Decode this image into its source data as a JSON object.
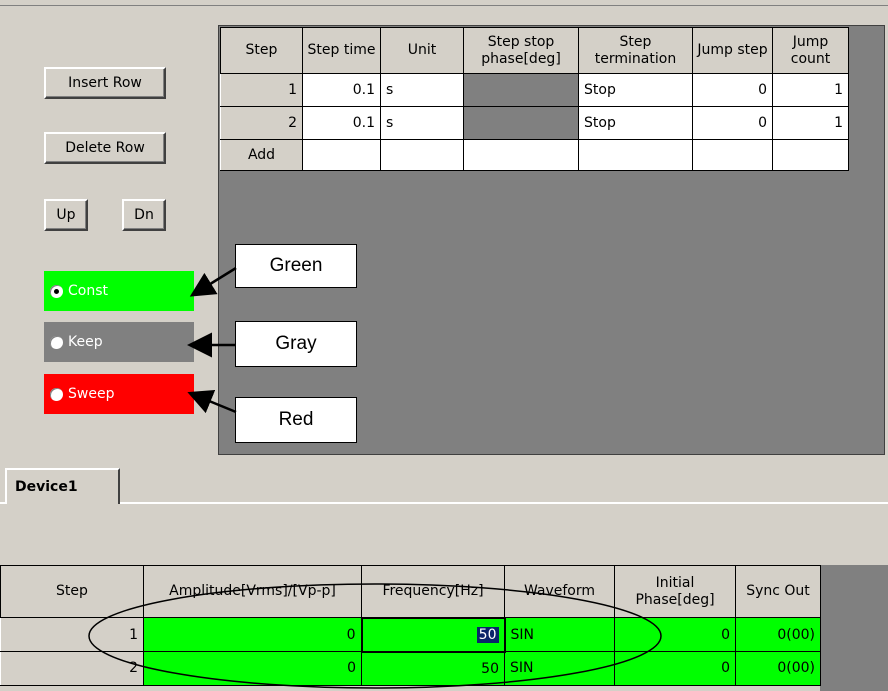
{
  "buttons": {
    "insert_row": "Insert Row",
    "delete_row": "Delete Row",
    "up": "Up",
    "dn": "Dn"
  },
  "modes": [
    {
      "label": "Const",
      "checked": true,
      "color": "#00ff00"
    },
    {
      "label": "Keep",
      "checked": false,
      "color": "#808080"
    },
    {
      "label": "Sweep",
      "checked": false,
      "color": "#ff0000"
    }
  ],
  "callouts": {
    "green": "Green",
    "gray": "Gray",
    "red": "Red"
  },
  "step_table": {
    "headers": {
      "step": "Step",
      "step_time": "Step time",
      "unit": "Unit",
      "phase": "Step stop phase[deg]",
      "termination": "Step termination",
      "jump_step": "Jump step",
      "jump_count": "Jump count"
    },
    "rows": [
      {
        "step": "1",
        "step_time": "0.1",
        "unit": "s",
        "termination": "Stop",
        "jump_step": "0",
        "jump_count": "1"
      },
      {
        "step": "2",
        "step_time": "0.1",
        "unit": "s",
        "termination": "Stop",
        "jump_step": "0",
        "jump_count": "1"
      }
    ],
    "add_label": "Add"
  },
  "tab": {
    "label": "Device1"
  },
  "device_table": {
    "headers": {
      "step": "Step",
      "amplitude": "Amplitude[Vrms]/[Vp-p]",
      "frequency": "Frequency[Hz]",
      "waveform": "Waveform",
      "initial_phase": "Initial Phase[deg]",
      "sync_out": "Sync Out"
    },
    "rows": [
      {
        "step": "1",
        "amplitude": "0",
        "frequency": "50",
        "waveform": "SIN",
        "phase": "0",
        "sync": "0(00)"
      },
      {
        "step": "2",
        "amplitude": "0",
        "frequency": "50",
        "waveform": "SIN",
        "phase": "0",
        "sync": "0(00)"
      }
    ]
  }
}
